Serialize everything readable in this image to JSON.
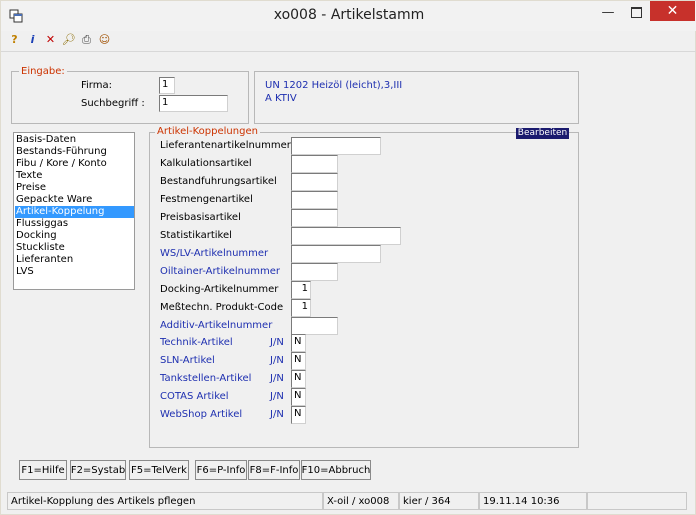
{
  "window": {
    "title": "xo008 - Artikelstamm"
  },
  "toolbar": {
    "icons": [
      "help-icon",
      "info-icon",
      "delete-icon",
      "search-icon",
      "print-icon",
      "user-icon"
    ]
  },
  "eingabe": {
    "legend": "Eingabe:",
    "firma_label": "Firma:",
    "firma_value": "1",
    "suchbegriff_label": "Suchbegriff :",
    "suchbegriff_value": "1"
  },
  "info": {
    "line1": "UN 1202 Heizöl (leicht),3,III",
    "line2": "A KTIV"
  },
  "nav": {
    "items": [
      "Basis-Daten",
      "Bestands-Führung",
      "Fibu / Kore / Konto",
      "Texte",
      "Preise",
      "Gepackte Ware",
      "Artikel-Koppelung",
      "Flussiggas",
      "Docking",
      "Stuckliste",
      "Lieferanten",
      "LVS"
    ],
    "selected": "Artikel-Koppelung"
  },
  "koppelung": {
    "legend": "Artikel-Koppelungen",
    "mode_badge": "Bearbeiten",
    "fields": [
      {
        "label": "Lieferantenartikelnummer",
        "value": ""
      },
      {
        "label": "Kalkulationsartikel",
        "value": ""
      },
      {
        "label": "Bestandfuhrungsartikel",
        "value": ""
      },
      {
        "label": "Festmengenartikel",
        "value": ""
      },
      {
        "label": "Preisbasisartikel",
        "value": ""
      },
      {
        "label": "Statistikartikel",
        "value": ""
      },
      {
        "label": "WS/LV-Artikelnummer",
        "value": ""
      },
      {
        "label": "Oiltainer-Artikelnummer",
        "value": ""
      },
      {
        "label": "Docking-Artikelnummer",
        "value": "1"
      },
      {
        "label": "Meßtechn. Produkt-Code",
        "value": "1"
      },
      {
        "label": "Additiv-Artikelnummer",
        "value": ""
      }
    ],
    "flags": [
      {
        "label": "Technik-Artikel",
        "hint": "J/N",
        "value": "N"
      },
      {
        "label": "SLN-Artikel",
        "hint": "J/N",
        "value": "N"
      },
      {
        "label": "Tankstellen-Artikel",
        "hint": "J/N",
        "value": "N"
      },
      {
        "label": "COTAS Artikel",
        "hint": "J/N",
        "value": "N"
      },
      {
        "label": "WebShop Artikel",
        "hint": "J/N",
        "value": "N"
      }
    ]
  },
  "fkeys": [
    "F1=Hilfe",
    "F2=Systab",
    "F5=TelVerk",
    "F6=P-Info",
    "F8=F-Info",
    "F10=Abbruch"
  ],
  "statusbar": {
    "message": "Artikel-Kopplung des Artikels pflegen",
    "system": "X-oil / xo008",
    "user": "kier / 364",
    "datetime": "19.11.14 10:36"
  }
}
